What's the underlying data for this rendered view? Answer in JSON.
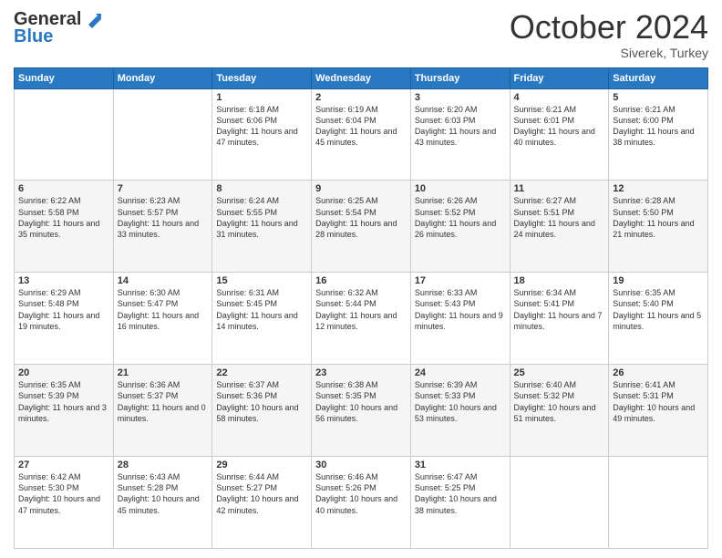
{
  "header": {
    "logo_general": "General",
    "logo_blue": "Blue",
    "month": "October 2024",
    "location": "Siverek, Turkey"
  },
  "days_of_week": [
    "Sunday",
    "Monday",
    "Tuesday",
    "Wednesday",
    "Thursday",
    "Friday",
    "Saturday"
  ],
  "weeks": [
    [
      {
        "day": "",
        "sunrise": "",
        "sunset": "",
        "daylight": ""
      },
      {
        "day": "",
        "sunrise": "",
        "sunset": "",
        "daylight": ""
      },
      {
        "day": "1",
        "sunrise": "Sunrise: 6:18 AM",
        "sunset": "Sunset: 6:06 PM",
        "daylight": "Daylight: 11 hours and 47 minutes."
      },
      {
        "day": "2",
        "sunrise": "Sunrise: 6:19 AM",
        "sunset": "Sunset: 6:04 PM",
        "daylight": "Daylight: 11 hours and 45 minutes."
      },
      {
        "day": "3",
        "sunrise": "Sunrise: 6:20 AM",
        "sunset": "Sunset: 6:03 PM",
        "daylight": "Daylight: 11 hours and 43 minutes."
      },
      {
        "day": "4",
        "sunrise": "Sunrise: 6:21 AM",
        "sunset": "Sunset: 6:01 PM",
        "daylight": "Daylight: 11 hours and 40 minutes."
      },
      {
        "day": "5",
        "sunrise": "Sunrise: 6:21 AM",
        "sunset": "Sunset: 6:00 PM",
        "daylight": "Daylight: 11 hours and 38 minutes."
      }
    ],
    [
      {
        "day": "6",
        "sunrise": "Sunrise: 6:22 AM",
        "sunset": "Sunset: 5:58 PM",
        "daylight": "Daylight: 11 hours and 35 minutes."
      },
      {
        "day": "7",
        "sunrise": "Sunrise: 6:23 AM",
        "sunset": "Sunset: 5:57 PM",
        "daylight": "Daylight: 11 hours and 33 minutes."
      },
      {
        "day": "8",
        "sunrise": "Sunrise: 6:24 AM",
        "sunset": "Sunset: 5:55 PM",
        "daylight": "Daylight: 11 hours and 31 minutes."
      },
      {
        "day": "9",
        "sunrise": "Sunrise: 6:25 AM",
        "sunset": "Sunset: 5:54 PM",
        "daylight": "Daylight: 11 hours and 28 minutes."
      },
      {
        "day": "10",
        "sunrise": "Sunrise: 6:26 AM",
        "sunset": "Sunset: 5:52 PM",
        "daylight": "Daylight: 11 hours and 26 minutes."
      },
      {
        "day": "11",
        "sunrise": "Sunrise: 6:27 AM",
        "sunset": "Sunset: 5:51 PM",
        "daylight": "Daylight: 11 hours and 24 minutes."
      },
      {
        "day": "12",
        "sunrise": "Sunrise: 6:28 AM",
        "sunset": "Sunset: 5:50 PM",
        "daylight": "Daylight: 11 hours and 21 minutes."
      }
    ],
    [
      {
        "day": "13",
        "sunrise": "Sunrise: 6:29 AM",
        "sunset": "Sunset: 5:48 PM",
        "daylight": "Daylight: 11 hours and 19 minutes."
      },
      {
        "day": "14",
        "sunrise": "Sunrise: 6:30 AM",
        "sunset": "Sunset: 5:47 PM",
        "daylight": "Daylight: 11 hours and 16 minutes."
      },
      {
        "day": "15",
        "sunrise": "Sunrise: 6:31 AM",
        "sunset": "Sunset: 5:45 PM",
        "daylight": "Daylight: 11 hours and 14 minutes."
      },
      {
        "day": "16",
        "sunrise": "Sunrise: 6:32 AM",
        "sunset": "Sunset: 5:44 PM",
        "daylight": "Daylight: 11 hours and 12 minutes."
      },
      {
        "day": "17",
        "sunrise": "Sunrise: 6:33 AM",
        "sunset": "Sunset: 5:43 PM",
        "daylight": "Daylight: 11 hours and 9 minutes."
      },
      {
        "day": "18",
        "sunrise": "Sunrise: 6:34 AM",
        "sunset": "Sunset: 5:41 PM",
        "daylight": "Daylight: 11 hours and 7 minutes."
      },
      {
        "day": "19",
        "sunrise": "Sunrise: 6:35 AM",
        "sunset": "Sunset: 5:40 PM",
        "daylight": "Daylight: 11 hours and 5 minutes."
      }
    ],
    [
      {
        "day": "20",
        "sunrise": "Sunrise: 6:35 AM",
        "sunset": "Sunset: 5:39 PM",
        "daylight": "Daylight: 11 hours and 3 minutes."
      },
      {
        "day": "21",
        "sunrise": "Sunrise: 6:36 AM",
        "sunset": "Sunset: 5:37 PM",
        "daylight": "Daylight: 11 hours and 0 minutes."
      },
      {
        "day": "22",
        "sunrise": "Sunrise: 6:37 AM",
        "sunset": "Sunset: 5:36 PM",
        "daylight": "Daylight: 10 hours and 58 minutes."
      },
      {
        "day": "23",
        "sunrise": "Sunrise: 6:38 AM",
        "sunset": "Sunset: 5:35 PM",
        "daylight": "Daylight: 10 hours and 56 minutes."
      },
      {
        "day": "24",
        "sunrise": "Sunrise: 6:39 AM",
        "sunset": "Sunset: 5:33 PM",
        "daylight": "Daylight: 10 hours and 53 minutes."
      },
      {
        "day": "25",
        "sunrise": "Sunrise: 6:40 AM",
        "sunset": "Sunset: 5:32 PM",
        "daylight": "Daylight: 10 hours and 51 minutes."
      },
      {
        "day": "26",
        "sunrise": "Sunrise: 6:41 AM",
        "sunset": "Sunset: 5:31 PM",
        "daylight": "Daylight: 10 hours and 49 minutes."
      }
    ],
    [
      {
        "day": "27",
        "sunrise": "Sunrise: 6:42 AM",
        "sunset": "Sunset: 5:30 PM",
        "daylight": "Daylight: 10 hours and 47 minutes."
      },
      {
        "day": "28",
        "sunrise": "Sunrise: 6:43 AM",
        "sunset": "Sunset: 5:28 PM",
        "daylight": "Daylight: 10 hours and 45 minutes."
      },
      {
        "day": "29",
        "sunrise": "Sunrise: 6:44 AM",
        "sunset": "Sunset: 5:27 PM",
        "daylight": "Daylight: 10 hours and 42 minutes."
      },
      {
        "day": "30",
        "sunrise": "Sunrise: 6:46 AM",
        "sunset": "Sunset: 5:26 PM",
        "daylight": "Daylight: 10 hours and 40 minutes."
      },
      {
        "day": "31",
        "sunrise": "Sunrise: 6:47 AM",
        "sunset": "Sunset: 5:25 PM",
        "daylight": "Daylight: 10 hours and 38 minutes."
      },
      {
        "day": "",
        "sunrise": "",
        "sunset": "",
        "daylight": ""
      },
      {
        "day": "",
        "sunrise": "",
        "sunset": "",
        "daylight": ""
      }
    ]
  ]
}
